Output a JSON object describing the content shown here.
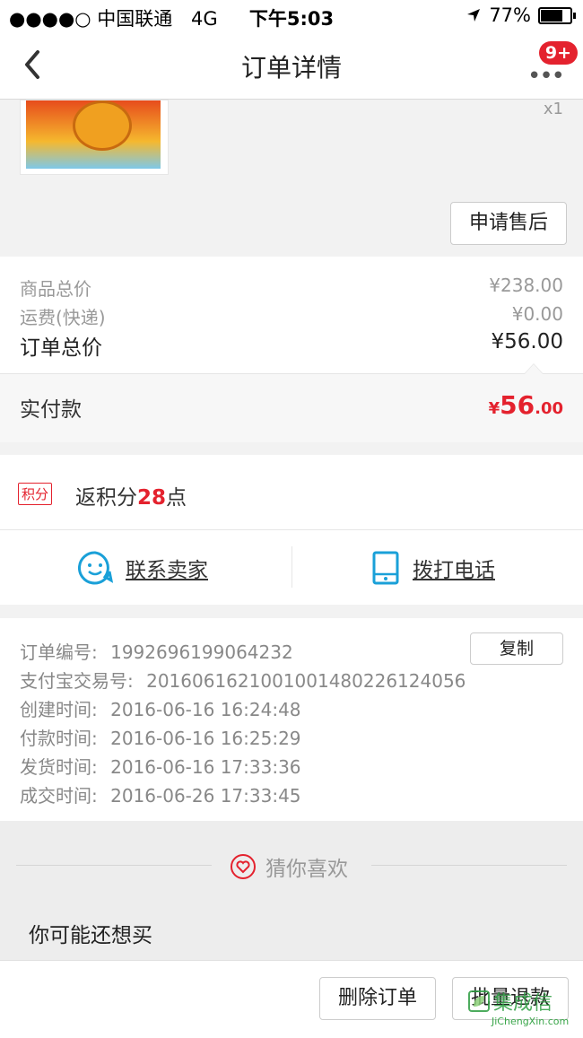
{
  "status_bar": {
    "carrier": "●●●●○ 中国联通",
    "network": "4G",
    "time": "下午5:03",
    "battery_pct": "77%"
  },
  "nav": {
    "title": "订单详情",
    "more_label": "•••",
    "badge": "9+"
  },
  "product": {
    "quantity": "x1",
    "after_sale_label": "申请售后"
  },
  "prices": {
    "goods_total_label": "商品总价",
    "goods_total_value": "¥238.00",
    "shipping_label": "运费(快递)",
    "shipping_value": "¥0.00",
    "order_total_label": "订单总价",
    "order_total_value": "¥56.00",
    "paid_label": "实付款",
    "paid_currency": "¥",
    "paid_int": "56",
    "paid_dec": ".00"
  },
  "points": {
    "tag": "积分",
    "text_prefix": "返积分",
    "amount": "28",
    "text_suffix": "点"
  },
  "contact": {
    "seller_label": "联系卖家",
    "phone_label": "拨打电话"
  },
  "order_info": {
    "order_no_label": "订单编号:",
    "order_no": "1992696199064232",
    "copy_label": "复制",
    "alipay_label": "支付宝交易号:",
    "alipay_no": "2016061621001001480226124056",
    "created_label": "创建时间:",
    "created": "2016-06-16 16:24:48",
    "paid_label": "付款时间:",
    "paid": "2016-06-16 16:25:29",
    "shipped_label": "发货时间:",
    "shipped": "2016-06-16 17:33:36",
    "deal_label": "成交时间:",
    "deal": "2016-06-26 17:33:45"
  },
  "guess": {
    "title": "猜你喜欢",
    "subtitle": "你可能还想买"
  },
  "bottom": {
    "delete_label": "删除订单",
    "refund_label": "批量退款"
  },
  "watermark": {
    "cn": "集成信",
    "en": "JiChengXin.com"
  },
  "colors": {
    "accent_red": "#e4222e",
    "icon_blue": "#1aa0d8"
  }
}
